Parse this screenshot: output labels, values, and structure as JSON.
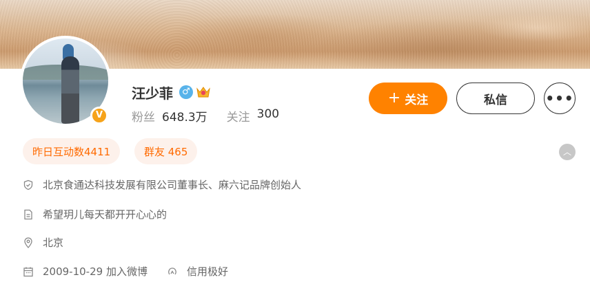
{
  "profile": {
    "name": "汪少菲",
    "followers_label": "粉丝",
    "followers_value": "648.3万",
    "following_label": "关注",
    "following_value": "300",
    "verified_mark": "V"
  },
  "actions": {
    "follow_label": "关注",
    "follow_icon": "+",
    "message_label": "私信",
    "more_label": "•••"
  },
  "tags": [
    {
      "label": "昨日互动数4411"
    },
    {
      "label": "群友 465"
    }
  ],
  "info": {
    "title": "北京食通达科技发展有限公司董事长、麻六记品牌创始人",
    "bio": "希望玥儿每天都开开心心的",
    "location": "北京",
    "joined": "2009-10-29 加入微博",
    "credit": "信用极好"
  },
  "icons": {
    "gender": "male-icon",
    "crown": "vip-crown-icon",
    "verified": "verified-badge-icon",
    "collapse": "chevron-up-icon",
    "title": "shield-icon",
    "bio": "document-icon",
    "location": "location-pin-icon",
    "joined": "calendar-icon",
    "credit": "credit-icon"
  },
  "colors": {
    "accent": "#ff8200",
    "tag_bg": "#fdf1eb",
    "tag_text": "#ff6a00",
    "gender": "#58b3ea",
    "verified": "#f6a31a"
  }
}
